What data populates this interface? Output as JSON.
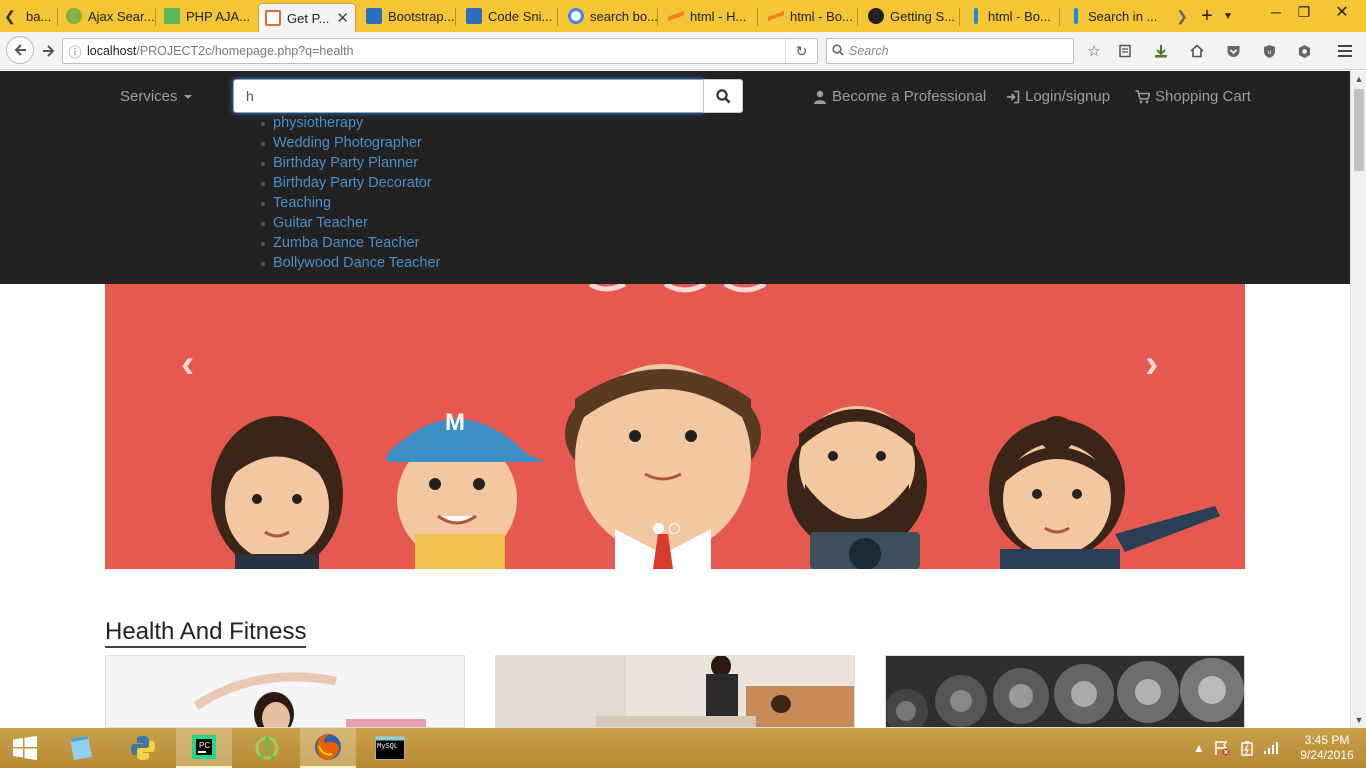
{
  "browser": {
    "tabs": [
      {
        "label": "ba...",
        "favicon_color": "#f0a030"
      },
      {
        "label": "Ajax Sear...",
        "favicon_color": "#7cb342"
      },
      {
        "label": "PHP AJA...",
        "favicon_color": "#5cb85c"
      },
      {
        "label": "Get P...",
        "favicon_color": "#e56a3a"
      },
      {
        "label": "Bootstrap...",
        "favicon_color": "#2a6ebb"
      },
      {
        "label": "Code Sni...",
        "favicon_color": "#2a6ebb"
      },
      {
        "label": "search bo...",
        "favicon_color": "#4285f4"
      },
      {
        "label": "html - H...",
        "favicon_color": "#f48024"
      },
      {
        "label": "html - Bo...",
        "favicon_color": "#f48024"
      },
      {
        "label": "Getting S...",
        "favicon_color": "#222222"
      },
      {
        "label": "html - Bo...",
        "favicon_color": "#1e88e5"
      },
      {
        "label": "Search in ...",
        "favicon_color": "#1e88e5"
      }
    ],
    "url_host": "localhost",
    "url_path": "/PROJECT2c/homepage.php?q=health",
    "search_placeholder": "Search"
  },
  "site": {
    "services_label": "Services",
    "search_value": "h",
    "suggestions": [
      "physiotherapy",
      "Wedding Photographer",
      "Birthday Party Planner",
      "Birthday Party Decorator",
      "Teaching",
      "Guitar Teacher",
      "Zumba Dance Teacher",
      "Bollywood Dance Teacher"
    ],
    "become_professional": "Become a Professional",
    "login_signup": "Login/signup",
    "shopping_cart": "Shopping Cart",
    "banner_badge_letter": "M",
    "section_title": "Health And Fitness"
  },
  "taskbar": {
    "time": "3:45 PM",
    "date": "9/24/2016",
    "mysql_label": "MySQL"
  },
  "colors": {
    "tabstrip": "#f4c534",
    "site_nav": "#222222",
    "suggestion_link": "#4a90c8",
    "banner": "#e5594e",
    "taskbar": "#c9a04a"
  }
}
